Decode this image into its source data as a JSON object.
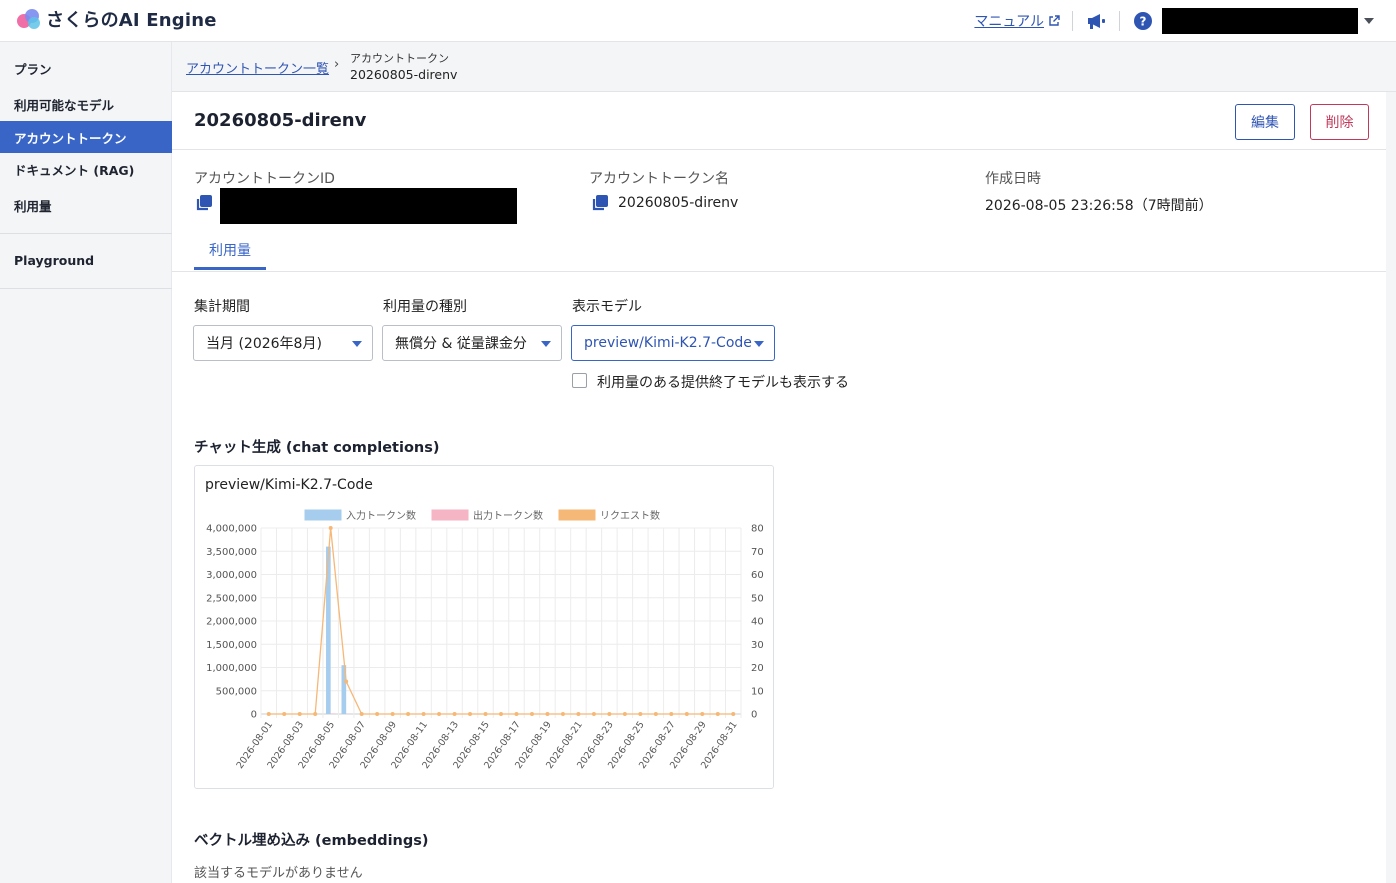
{
  "app": {
    "logo_text": "さくらのAI Engine"
  },
  "topbar": {
    "manual_label": "マニュアル"
  },
  "sidebar": {
    "items": [
      {
        "label": "プラン"
      },
      {
        "label": "利用可能なモデル"
      },
      {
        "label": "アカウントトークン"
      },
      {
        "label": "ドキュメント (RAG)"
      },
      {
        "label": "利用量"
      },
      {
        "label": "Playground"
      }
    ]
  },
  "breadcrumb": {
    "parent": "アカウントトークン一覧",
    "separator": "›",
    "current_type": "アカウントトークン",
    "current_name": "20260805-direnv"
  },
  "page": {
    "title": "20260805-direnv",
    "edit_label": "編集",
    "delete_label": "削除"
  },
  "fields": {
    "id_label": "アカウントトークンID",
    "name_label": "アカウントトークン名",
    "name_value": "20260805-direnv",
    "created_label": "作成日時",
    "created_value": "2026-08-05 23:26:58（7時間前）"
  },
  "tabs": [
    {
      "label": "利用量"
    }
  ],
  "filters": {
    "period_label": "集計期間",
    "period_value": "当月 (2026年8月)",
    "type_label": "利用量の種別",
    "type_value": "無償分 & 従量課金分",
    "model_label": "表示モデル",
    "model_value": "preview/Kimi-K2.7-Code",
    "show_deprecated_label": "利用量のある提供終了モデルも表示する",
    "show_deprecated_checked": false
  },
  "sections": {
    "chat_title": "チャット生成 (chat completions)",
    "embed_title": "ベクトル埋め込み (embeddings)",
    "embed_empty": "該当するモデルがありません"
  },
  "colors": {
    "accent": "#3965c7",
    "danger": "#c0395a",
    "input_series": "#a6cdee",
    "output_series": "#f5b5c4",
    "request_series": "#f5b877"
  },
  "chart_data": {
    "type": "bar",
    "title": "preview/Kimi-K2.7-Code",
    "legend_position": "top",
    "grid": true,
    "x": [
      "2026-08-01",
      "2026-08-02",
      "2026-08-03",
      "2026-08-04",
      "2026-08-05",
      "2026-08-06",
      "2026-08-07",
      "2026-08-08",
      "2026-08-09",
      "2026-08-10",
      "2026-08-11",
      "2026-08-12",
      "2026-08-13",
      "2026-08-14",
      "2026-08-15",
      "2026-08-16",
      "2026-08-17",
      "2026-08-18",
      "2026-08-19",
      "2026-08-20",
      "2026-08-21",
      "2026-08-22",
      "2026-08-23",
      "2026-08-24",
      "2026-08-25",
      "2026-08-26",
      "2026-08-27",
      "2026-08-28",
      "2026-08-29",
      "2026-08-30",
      "2026-08-31"
    ],
    "x_tick_labels": [
      "2026-08-01",
      "2026-08-03",
      "2026-08-05",
      "2026-08-07",
      "2026-08-09",
      "2026-08-11",
      "2026-08-13",
      "2026-08-15",
      "2026-08-17",
      "2026-08-19",
      "2026-08-21",
      "2026-08-23",
      "2026-08-25",
      "2026-08-27",
      "2026-08-29",
      "2026-08-31"
    ],
    "y_left": {
      "min": 0,
      "max": 4000000,
      "tick_labels": [
        "0",
        "500,000",
        "1,000,000",
        "1,500,000",
        "2,000,000",
        "2,500,000",
        "3,000,000",
        "3,500,000",
        "4,000,000"
      ]
    },
    "y_right": {
      "min": 0,
      "max": 80,
      "tick_labels": [
        "0",
        "10",
        "20",
        "30",
        "40",
        "50",
        "60",
        "70",
        "80"
      ]
    },
    "series": [
      {
        "name": "入力トークン数",
        "kind": "bar",
        "axis": "left",
        "values": [
          0,
          0,
          0,
          0,
          3600000,
          1050000,
          0,
          0,
          0,
          0,
          0,
          0,
          0,
          0,
          0,
          0,
          0,
          0,
          0,
          0,
          0,
          0,
          0,
          0,
          0,
          0,
          0,
          0,
          0,
          0,
          0
        ]
      },
      {
        "name": "出力トークン数",
        "kind": "bar",
        "axis": "left",
        "values": [
          0,
          0,
          0,
          0,
          12000,
          5000,
          0,
          0,
          0,
          0,
          0,
          0,
          0,
          0,
          0,
          0,
          0,
          0,
          0,
          0,
          0,
          0,
          0,
          0,
          0,
          0,
          0,
          0,
          0,
          0,
          0
        ]
      },
      {
        "name": "リクエスト数",
        "kind": "line",
        "axis": "right",
        "values": [
          0,
          0,
          0,
          0,
          80,
          14,
          0,
          0,
          0,
          0,
          0,
          0,
          0,
          0,
          0,
          0,
          0,
          0,
          0,
          0,
          0,
          0,
          0,
          0,
          0,
          0,
          0,
          0,
          0,
          0,
          0
        ]
      }
    ]
  }
}
